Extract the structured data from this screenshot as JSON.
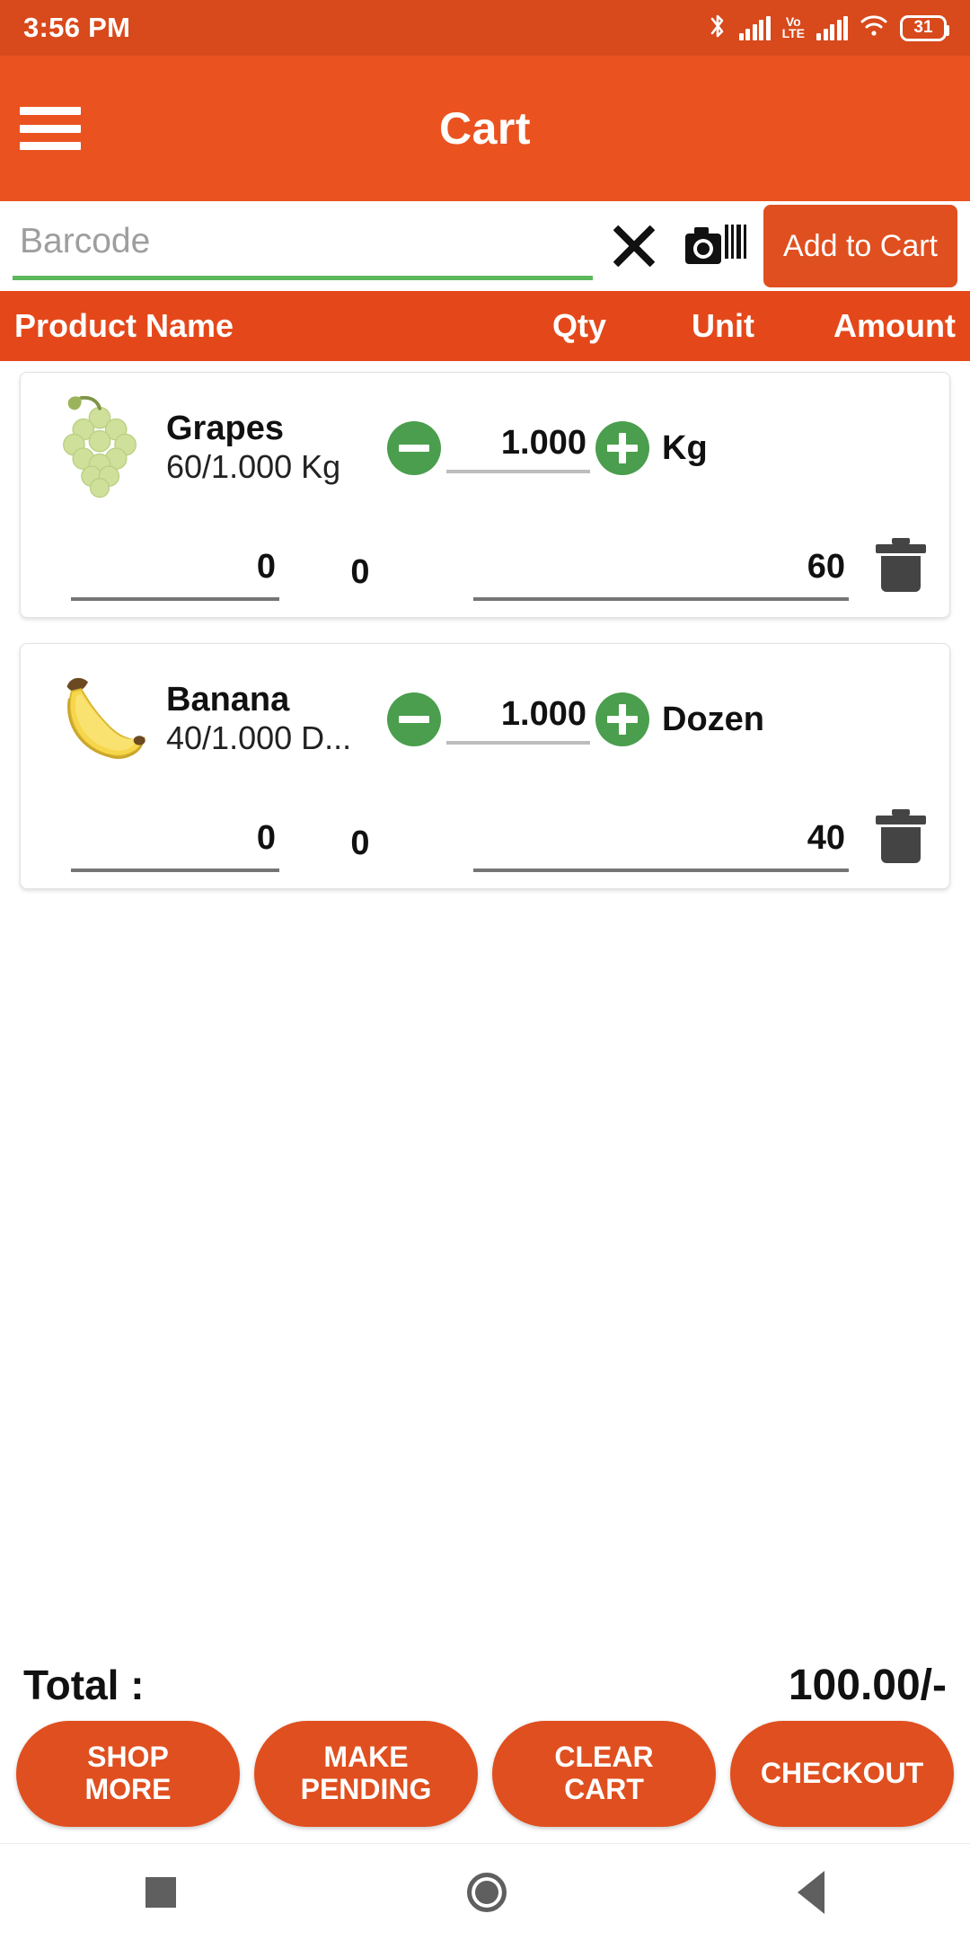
{
  "status_bar": {
    "time": "3:56 PM",
    "battery_percent": "31",
    "volte_top": "Vo",
    "volte_bottom": "LTE",
    "icons": [
      "bluetooth-icon",
      "signal-bars-icon",
      "volte-icon",
      "signal-bars-icon",
      "wifi-icon",
      "battery-icon"
    ]
  },
  "appbar": {
    "title": "Cart",
    "menu_icon": "hamburger-menu-icon",
    "background": "#ea5320"
  },
  "barcode": {
    "placeholder": "Barcode",
    "value": "",
    "clear_icon": "close-x-icon",
    "scan_icon": "barcode-scanner-icon",
    "add_button": "Add to Cart",
    "underline_color": "#5cb85c"
  },
  "table_header": {
    "product_name": "Product Name",
    "qty": "Qty",
    "unit": "Unit",
    "amount": "Amount"
  },
  "cart_items": [
    {
      "name": "Grapes",
      "rate_line": "60/1.000 Kg",
      "image": "grapes-thumbnail",
      "quantity": "1.000",
      "unit": "Kg",
      "discount": "0",
      "middle_value": "0",
      "amount": "60",
      "decrement_icon": "minus-circle-icon",
      "increment_icon": "plus-circle-icon",
      "delete_icon": "trash-icon"
    },
    {
      "name": "Banana",
      "rate_line": "40/1.000 D...",
      "image": "banana-thumbnail",
      "quantity": "1.000",
      "unit": "Dozen",
      "discount": "0",
      "middle_value": "0",
      "amount": "40",
      "decrement_icon": "minus-circle-icon",
      "increment_icon": "plus-circle-icon",
      "delete_icon": "trash-icon"
    }
  ],
  "footer": {
    "total_label": "Total :",
    "total_value": "100.00/-",
    "buttons": [
      {
        "label": "SHOP\nMORE"
      },
      {
        "label": "MAKE\nPENDING"
      },
      {
        "label": "CLEAR\nCART"
      },
      {
        "label": "CHECKOUT"
      }
    ]
  },
  "navbar": {
    "recents": "recents-square-icon",
    "home": "home-circle-icon",
    "back": "back-triangle-icon"
  },
  "colors": {
    "primary_orange": "#ea5320",
    "statusbar_orange": "#d8491c",
    "button_orange": "#e04f1f",
    "header_orange": "#e4481a",
    "green": "#4a9e4d",
    "underline_green": "#5cb85c",
    "trash_gray": "#444444"
  }
}
